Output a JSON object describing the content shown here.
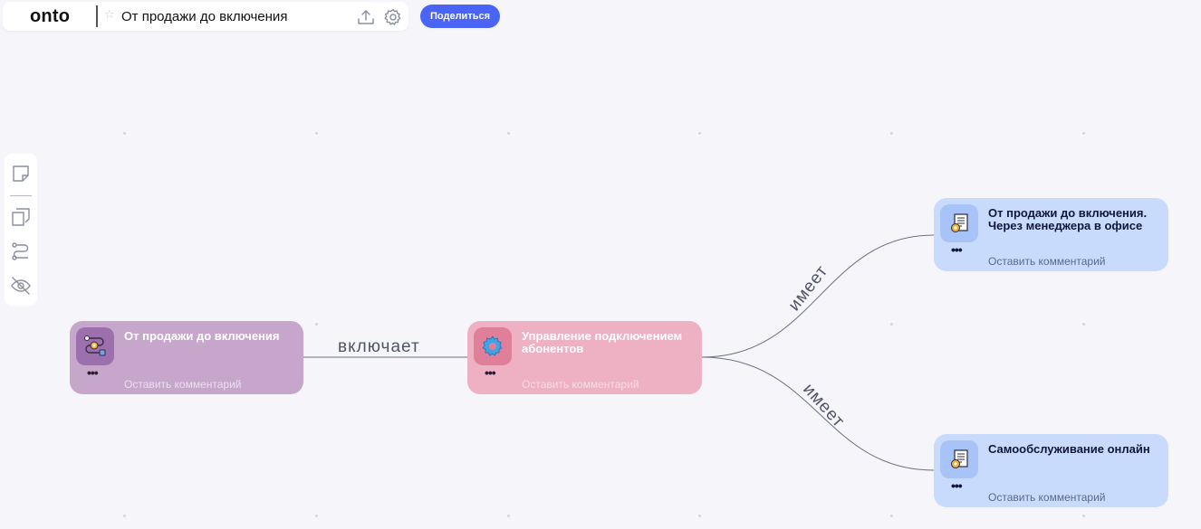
{
  "app": {
    "logo": "onto"
  },
  "document": {
    "title": "От продажи до включения"
  },
  "header": {
    "share_label": "Поделиться",
    "icons": [
      "star-icon",
      "upload-icon",
      "settings-icon"
    ]
  },
  "toolbar": {
    "tools": [
      "sticky-note-icon",
      "copy-notes-icon",
      "connector-route-icon",
      "hide-eye-icon"
    ]
  },
  "nodes": [
    {
      "title": "От продажи до включения",
      "comment": "Оставить комментарий",
      "icon": "process-flow-icon",
      "color": "#c6a7cb"
    },
    {
      "title": "Управление подключением абонентов",
      "comment": "Оставить комментарий",
      "icon": "gear-icon",
      "color": "#eeb1c4"
    },
    {
      "title": "От продажи до включения. Через менеджера в офисе",
      "comment": "Оставить комментарий",
      "icon": "document-gear-icon",
      "color": "#c9dbfd"
    },
    {
      "title": "Самообслуживание онлайн",
      "comment": "Оставить комментарий",
      "icon": "document-gear-icon",
      "color": "#c9dbfd"
    }
  ],
  "edges": [
    {
      "label": "включает"
    },
    {
      "label": "имеет"
    },
    {
      "label": "имеет"
    }
  ],
  "node_menu_glyph": "•••",
  "colors": {
    "accent": "#4a64f5",
    "background": "#f5f5fa",
    "edge": "#6b7080"
  }
}
